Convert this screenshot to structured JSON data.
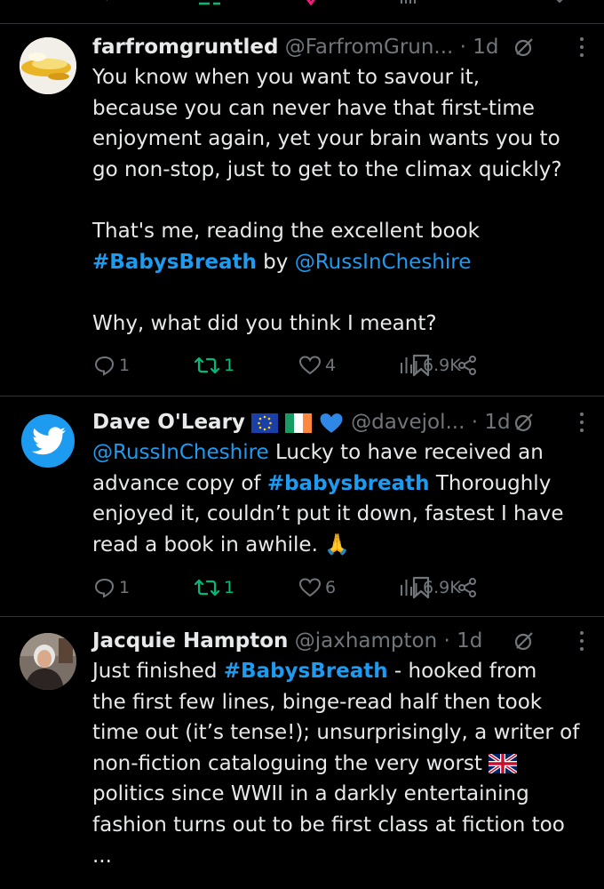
{
  "tweets": [
    {
      "name": "farfromgruntled",
      "handle": "@FarfromGrun...",
      "time": "· 1d",
      "lines": [
        "You know when you want to savour it,",
        "because you can never have that first-time",
        "enjoyment again, yet your brain wants you to",
        "go non-stop, just to get to the climax quickly?",
        "",
        "That's me, reading the excellent book",
        "#BabysBreath",
        " by ",
        "@RussInCheshire",
        "",
        "Why, what did you think I meant?"
      ],
      "replies": "1",
      "reposts": "1",
      "likes": "4",
      "views": "6.9K"
    },
    {
      "name": "Dave O'Leary",
      "handle": "@davejol...",
      "time": "· 1d",
      "mention": "@RussInCheshire",
      "line1_rest": " Lucky to have received an",
      "line2_a": "advance copy of ",
      "hashtag": "#babysbreath",
      "line2_b": " Thoroughly",
      "line3": "enjoyed it, couldn’t put it down, fastest I have",
      "line4": "read a book in awhile. ",
      "emoji": "🙏",
      "replies": "1",
      "reposts": "1",
      "likes": "6",
      "views": "6.9K"
    },
    {
      "name": "Jacquie Hampton",
      "handle": "@jaxhampton",
      "time": "· 1d",
      "line1_a": "Just finished ",
      "hashtag": "#BabysBreath",
      "line1_b": " - hooked from",
      "line2": "the first few lines, binge-read half then took",
      "line3": "time out (it’s tense!); unsurprisingly, a writer of",
      "line4": "non-fiction cataloguing the very worst ",
      "line5": "politics since WWII in a darkly entertaining",
      "line6": "fashion turns out to be first class at fiction too",
      "line7": "..."
    }
  ],
  "colors": {
    "accent": "#1d9bf0",
    "repost": "#00ba7c",
    "muted": "#71767b",
    "text": "#e7e9ea",
    "background": "#000000"
  },
  "icons": [
    "reply-icon",
    "repost-icon",
    "like-icon",
    "views-icon",
    "bookmark-icon",
    "share-icon",
    "grok-icon",
    "more-icon"
  ]
}
